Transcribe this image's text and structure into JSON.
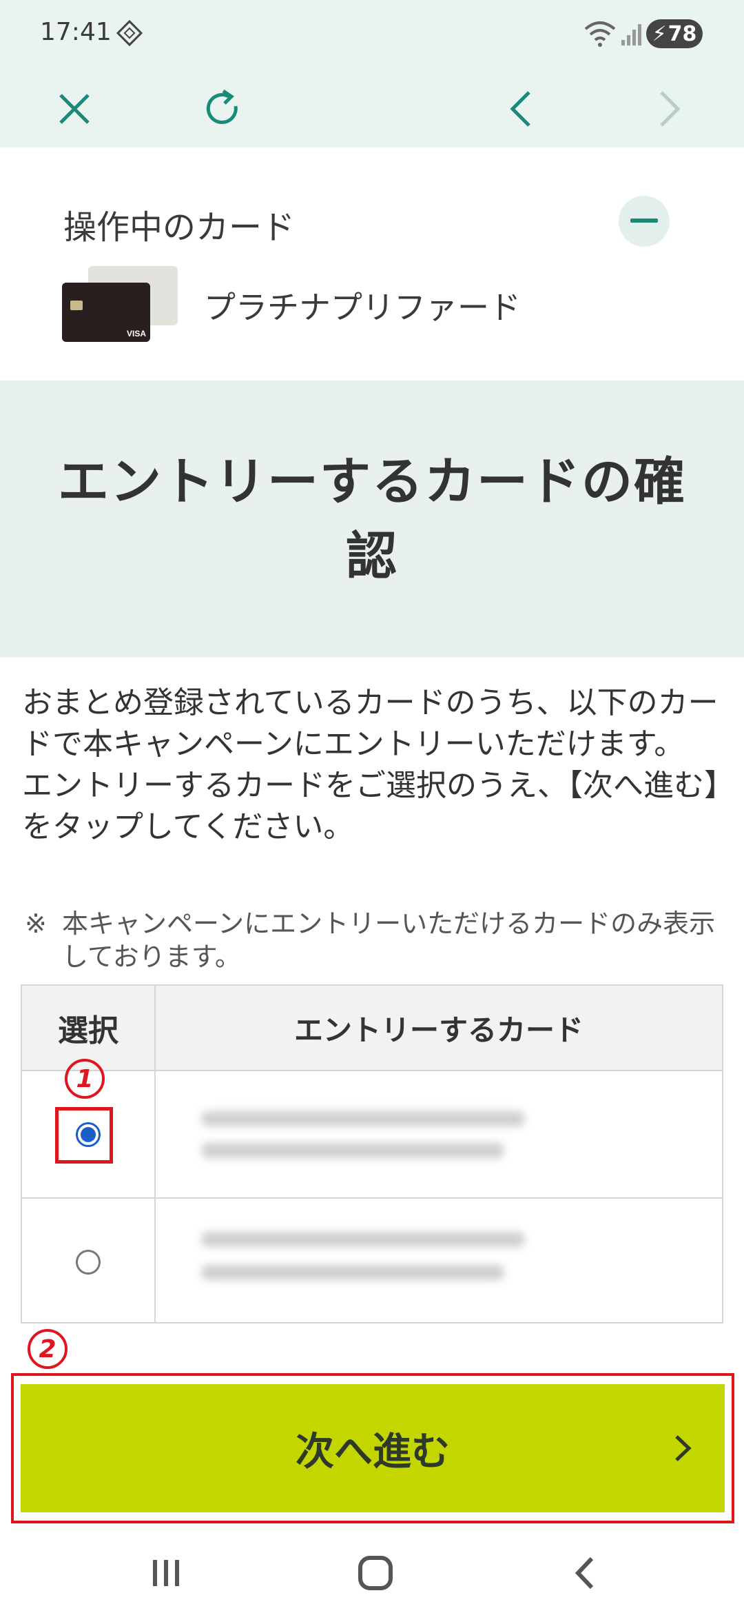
{
  "status_bar": {
    "time": "17:41",
    "battery": "78",
    "icons": [
      "notification-icon",
      "wifi-icon",
      "signal-icon",
      "battery-icon"
    ]
  },
  "toolbar": {
    "icons": [
      "close-icon",
      "reload-icon",
      "back-icon",
      "forward-icon"
    ]
  },
  "current_card": {
    "title": "操作中のカード",
    "card_name": "プラチナプリファード"
  },
  "banner": {
    "heading": "エントリーするカードの確認"
  },
  "description": {
    "paragraph1": "おまとめ登録されているカードのうち、以下のカードで本キャンペーンにエントリーいただけます。",
    "paragraph2": "エントリーするカードをご選択のうえ、【次へ進む】をタップしてください。",
    "note_mark": "※",
    "note": "本キャンペーンにエントリーいただけるカードのみ表示しております。"
  },
  "table": {
    "headers": [
      "選択",
      "エントリーするカード"
    ],
    "rows": [
      {
        "selected": true
      },
      {
        "selected": false
      }
    ]
  },
  "annotations": {
    "marker1": "1",
    "marker2": "2"
  },
  "next_button": {
    "label": "次へ進む"
  },
  "colors": {
    "accent": "#1a8a78",
    "header_bg": "#e9f4f1",
    "button_bg": "#c4d600",
    "annotation_red": "#e0161e",
    "radio_blue": "#1a5fc7"
  }
}
